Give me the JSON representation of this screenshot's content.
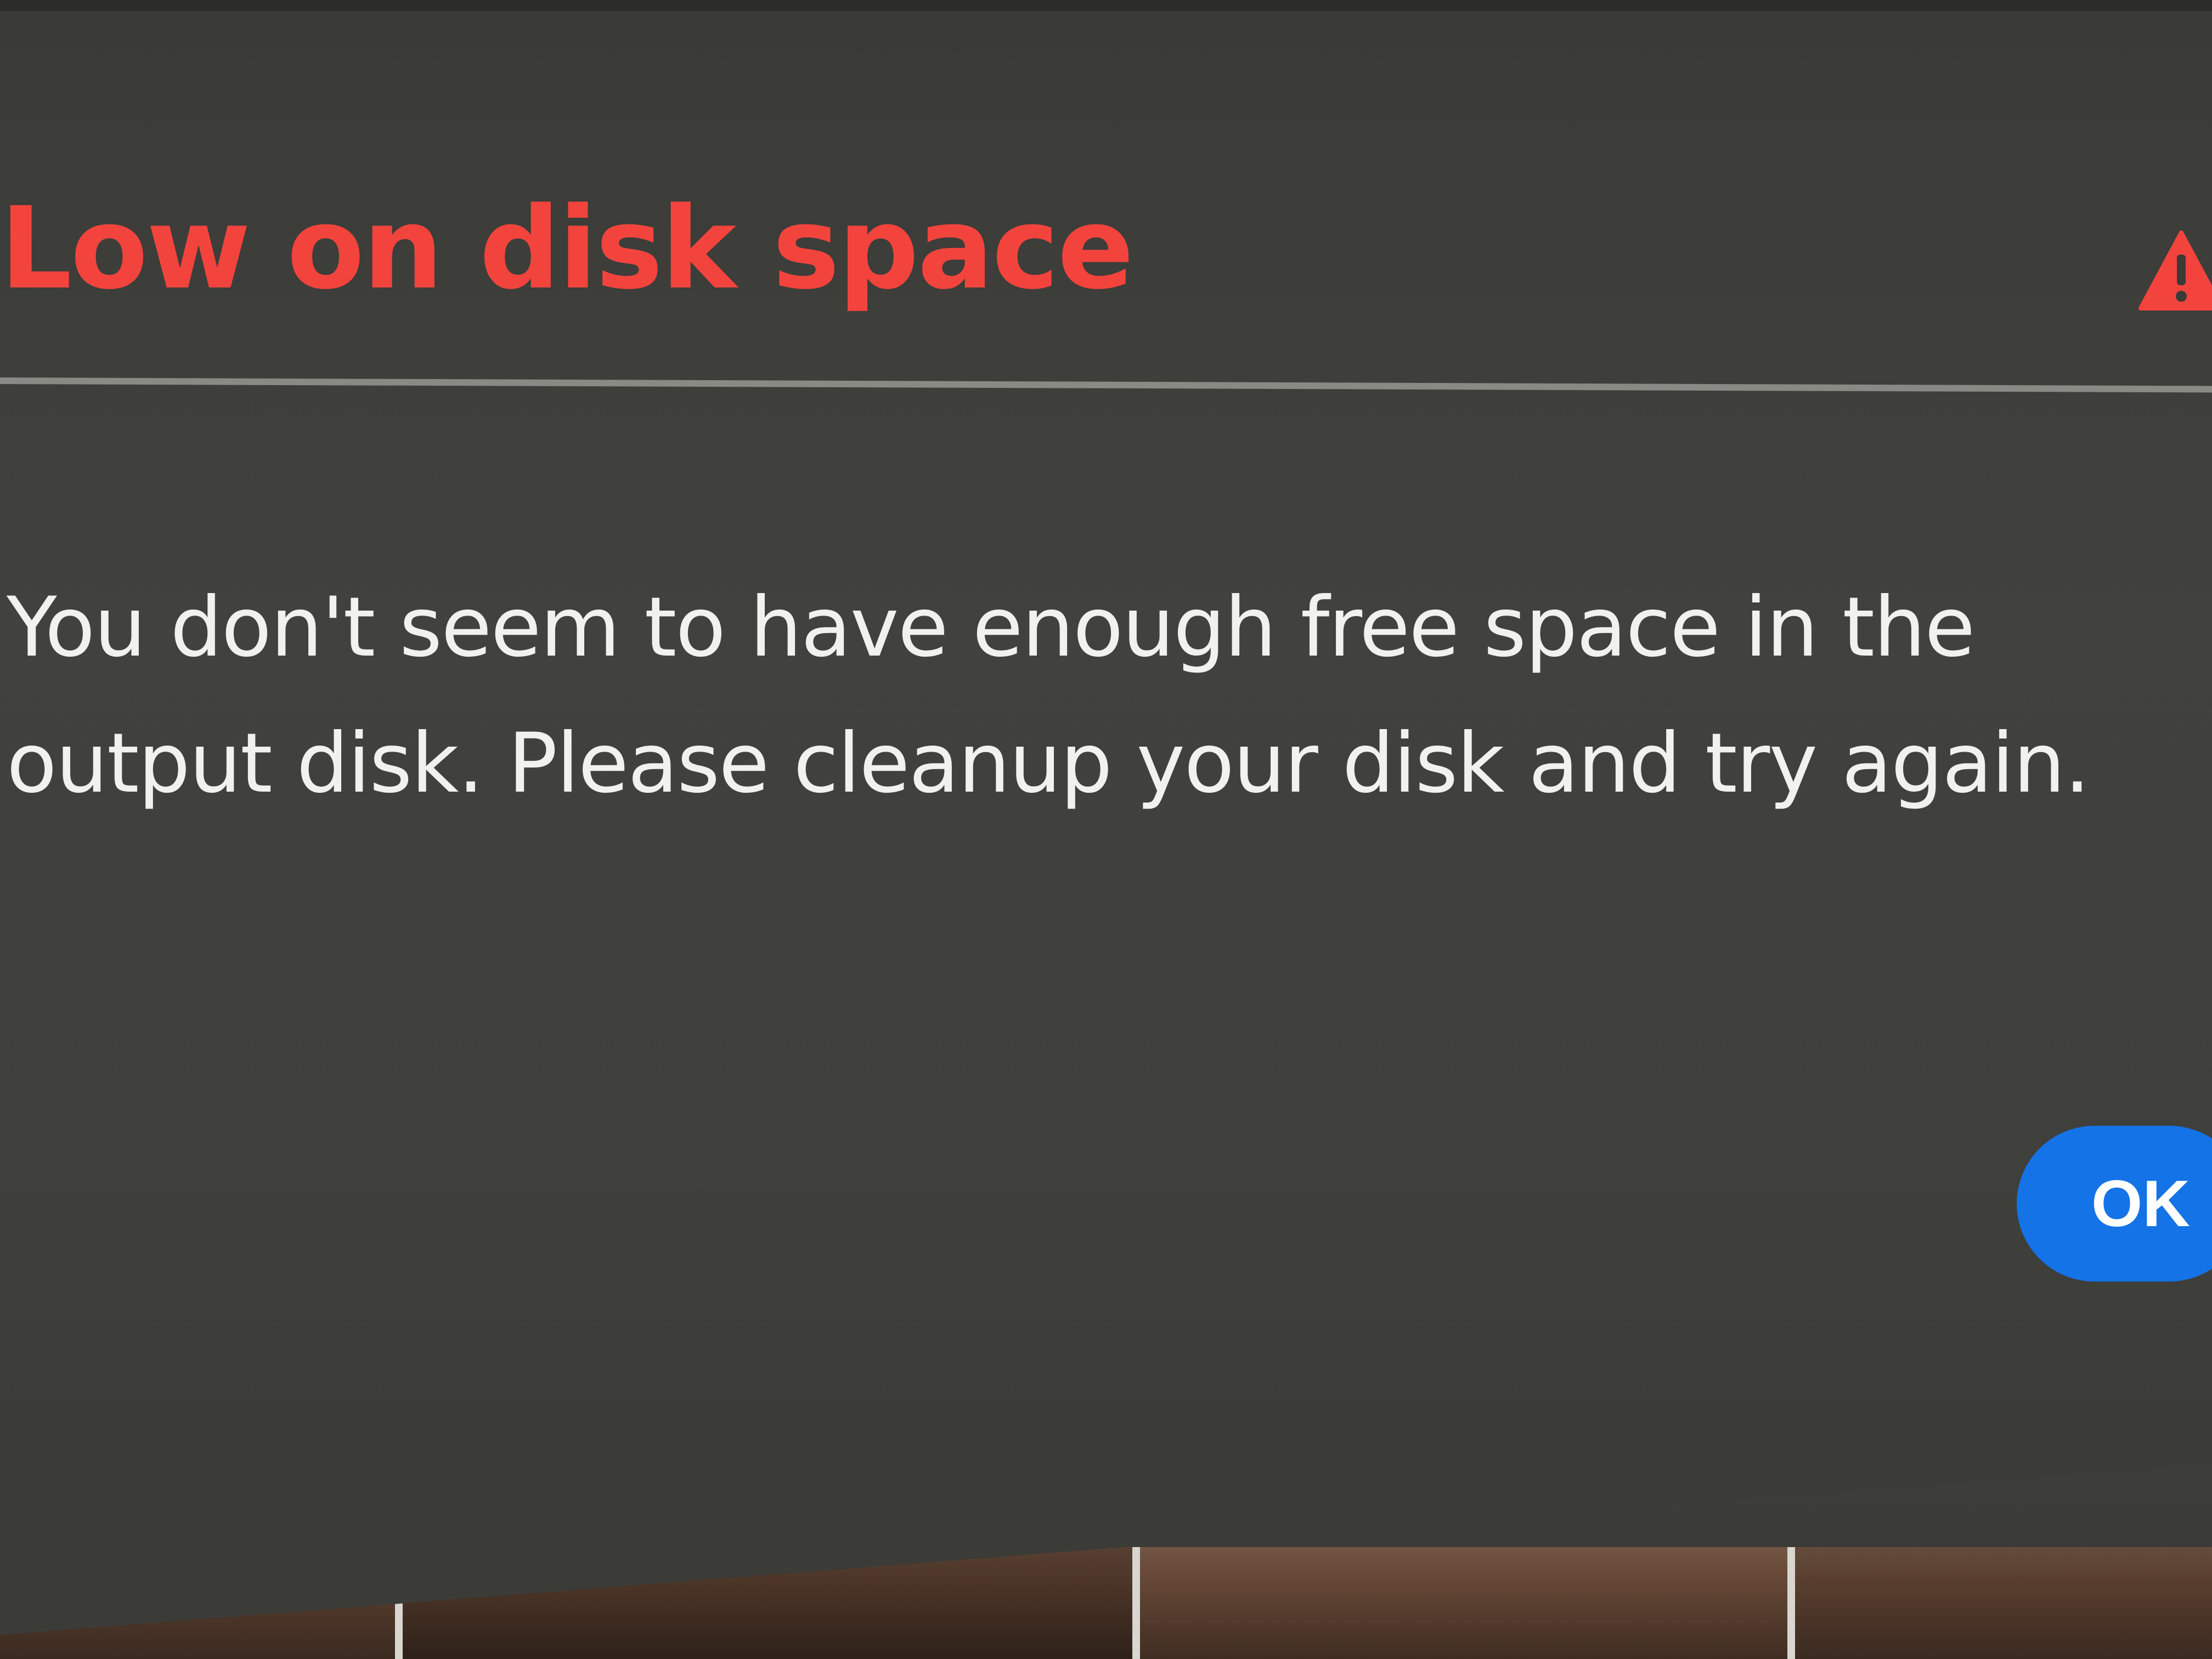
{
  "dialog": {
    "title": "Low on disk space",
    "message": "You don't seem to have enough free space in the output disk. Please cleanup your disk and try again.",
    "ok_label": "OK",
    "icon": "alert-triangle-icon"
  },
  "colors": {
    "title": "#f2443d",
    "alert_icon": "#f2443d",
    "primary_button": "#1473e6",
    "dialog_background": "#3d3d3a",
    "message_text": "#f1f1ef"
  }
}
